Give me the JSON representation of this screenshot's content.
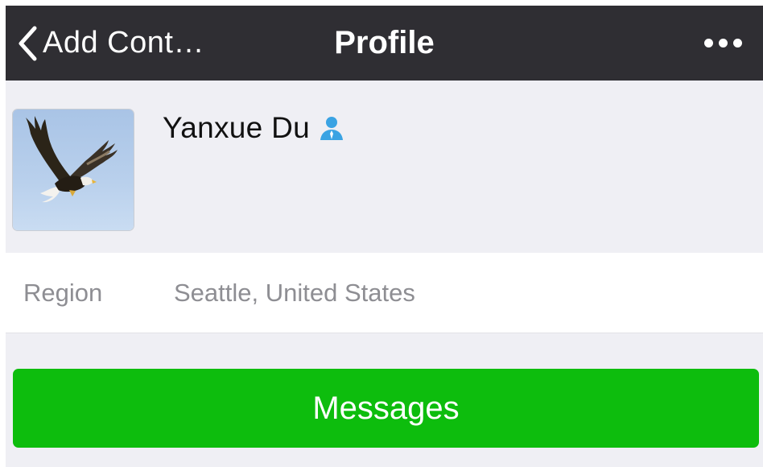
{
  "navbar": {
    "back_label": "Add Cont…",
    "title": "Profile",
    "more_icon": "more-icon"
  },
  "profile": {
    "name": "Yanxue Du",
    "badge_icon": "contact-person-icon",
    "badge_color": "#3aa3e3",
    "avatar": "eagle-photo"
  },
  "details": {
    "region_label": "Region",
    "region_value": "Seattle, United States"
  },
  "actions": {
    "messages_label": "Messages",
    "messages_color": "#0dbd0d"
  },
  "colors": {
    "navbar_bg": "#2f2e33",
    "page_bg": "#efeff4",
    "secondary_text": "#8e8e93"
  }
}
